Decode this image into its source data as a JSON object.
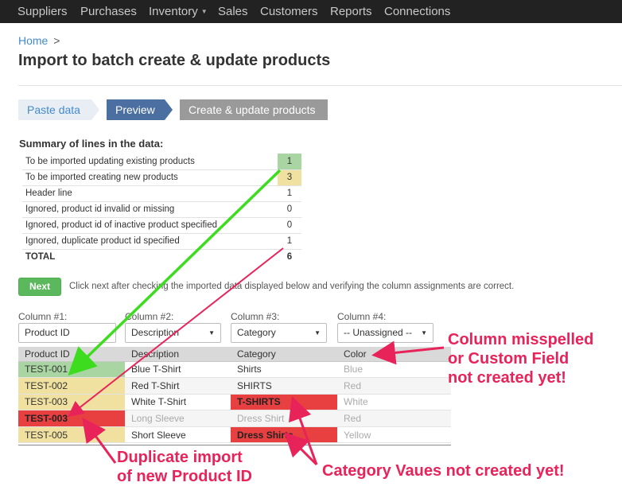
{
  "nav": {
    "items": [
      "Suppliers",
      "Purchases",
      "Inventory",
      "Sales",
      "Customers",
      "Reports",
      "Connections"
    ],
    "caret_icon": "chevron-down-icon"
  },
  "breadcrumb": {
    "home": "Home",
    "separator": ">"
  },
  "page_title": "Import to batch create & update products",
  "steps": [
    "Paste data",
    "Preview",
    "Create & update products"
  ],
  "summary": {
    "heading": "Summary of lines in the data:",
    "rows": [
      {
        "label": "To be imported updating existing products",
        "value": "1"
      },
      {
        "label": "To be imported creating new products",
        "value": "3"
      },
      {
        "label": "Header line",
        "value": "1"
      },
      {
        "label": "Ignored, product id invalid or missing",
        "value": "0"
      },
      {
        "label": "Ignored, product id of inactive product specified",
        "value": "0"
      },
      {
        "label": "Ignored, duplicate product id specified",
        "value": "1"
      },
      {
        "label": "TOTAL",
        "value": "6"
      }
    ]
  },
  "next": {
    "label": "Next",
    "hint": "Click next after checking the imported data displayed below and verifying the column assignments are correct."
  },
  "columns": [
    {
      "label": "Column #1:",
      "value": "Product ID"
    },
    {
      "label": "Column #2:",
      "value": "Description"
    },
    {
      "label": "Column #3:",
      "value": "Category"
    },
    {
      "label": "Column #4:",
      "value": "-- Unassigned --"
    }
  ],
  "preview": {
    "headers": [
      "Product ID",
      "Description",
      "Category",
      "Color"
    ],
    "rows": [
      [
        "TEST-001",
        "Blue T-Shirt",
        "Shirts",
        "Blue"
      ],
      [
        "TEST-002",
        "Red T-Shirt",
        "SHIRTS",
        "Red"
      ],
      [
        "TEST-003",
        "White T-Shirt",
        "T-SHIRTS",
        "White"
      ],
      [
        "TEST-003",
        "Long Sleeve",
        "Dress Shirt",
        "Red"
      ],
      [
        "TEST-005",
        "Short Sleeve",
        "Dress Shirts",
        "Yellow"
      ]
    ]
  },
  "annotations": {
    "column": [
      "Column misspelled",
      "or Custom Field",
      "not created yet!"
    ],
    "duplicate": [
      "Duplicate import",
      "of new Product ID"
    ],
    "category": "Category Vaues not created yet!"
  },
  "colors": {
    "green_arrow": "#3ddc1f",
    "pink_arrow": "#e8235a",
    "status_green": "#a9d5a2",
    "status_yellow": "#f0e1a0",
    "status_red": "#e84040"
  }
}
